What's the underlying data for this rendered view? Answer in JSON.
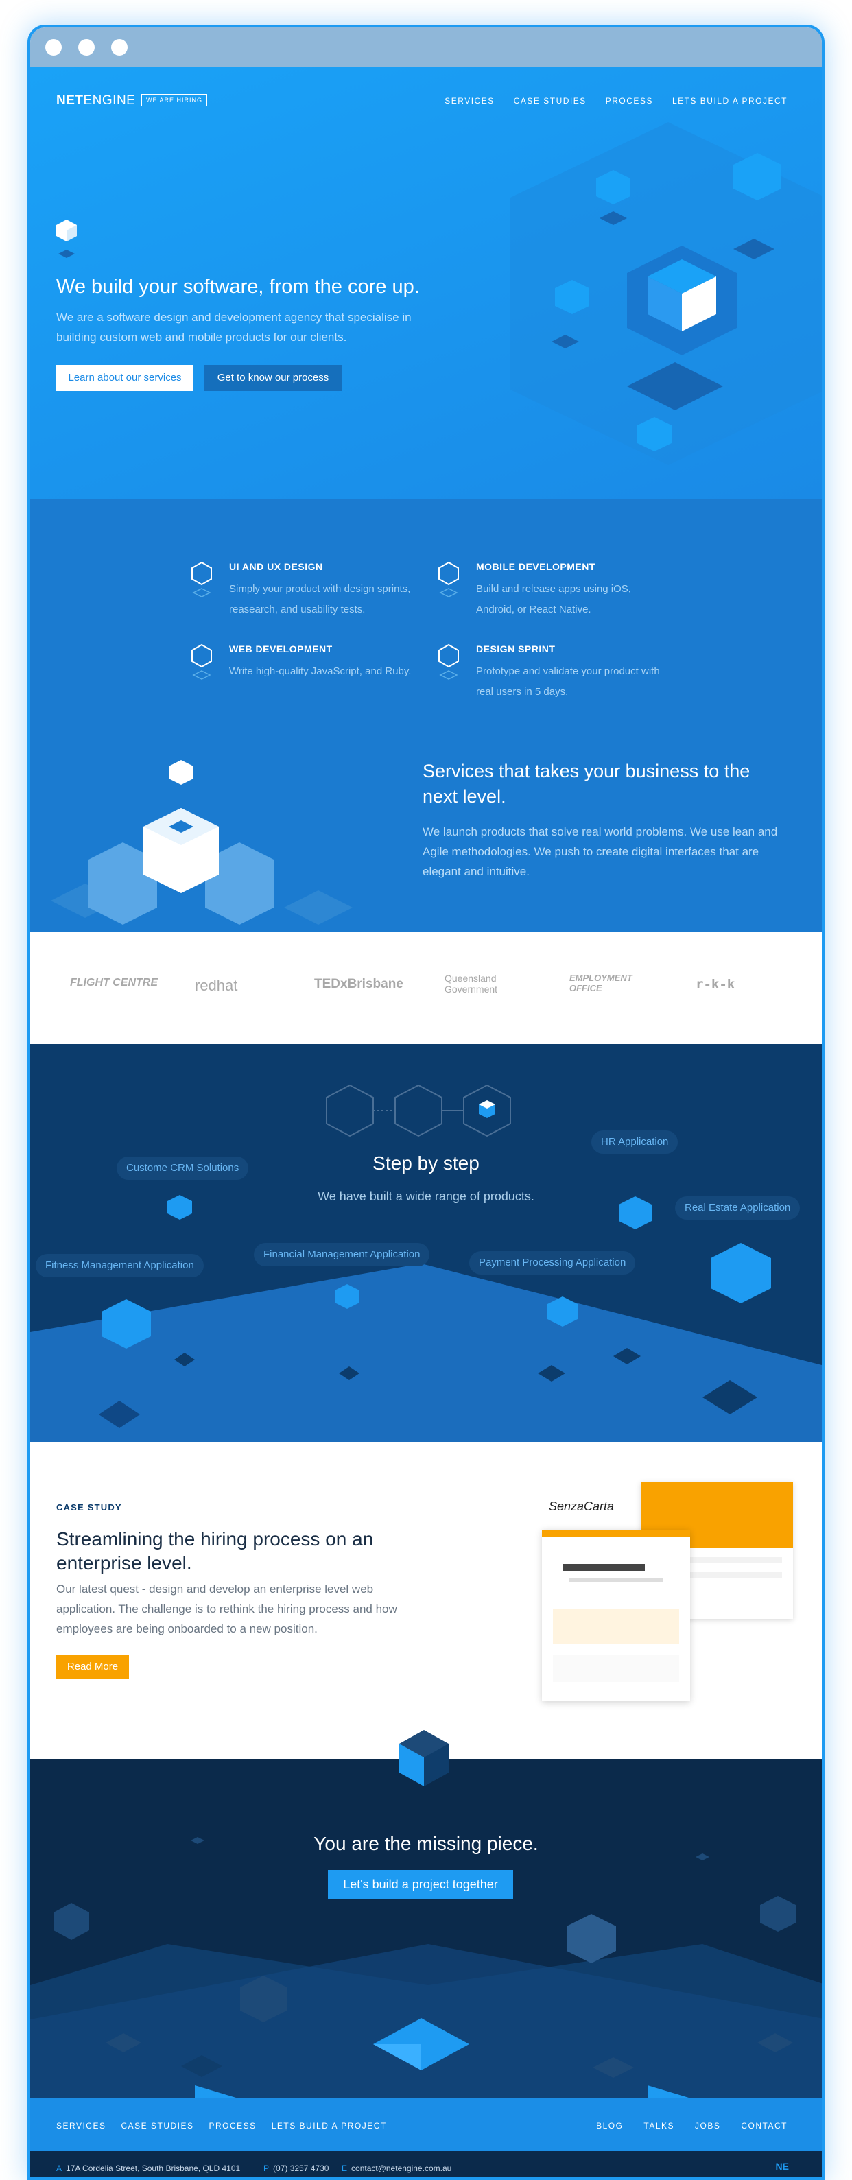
{
  "nav": {
    "logo_bold": "NET",
    "logo_rest": "ENGINE",
    "hiring_badge": "WE ARE HIRING",
    "links": [
      "SERVICES",
      "CASE STUDIES",
      "PROCESS",
      "LETS BUILD A PROJECT"
    ]
  },
  "hero": {
    "title": "We build your software, from the core up.",
    "subtitle": "We are a software design and development agency that specialise in building  custom web and mobile products for our clients.",
    "primary_button": "Learn about our services",
    "secondary_button": "Get to know our process"
  },
  "services": {
    "items": [
      {
        "title": "UI AND UX DESIGN",
        "text": "Simply your product with design sprints, reasearch, and usability tests."
      },
      {
        "title": "MOBILE DEVELOPMENT",
        "text": "Build and release apps using iOS, Android, or React Native."
      },
      {
        "title": "WEB DEVELOPMENT",
        "text": "Write high-quality JavaScript, and Ruby."
      },
      {
        "title": "DESIGN SPRINT",
        "text": "Prototype and validate your product with real users in 5 days."
      }
    ],
    "headline": "Services that takes your business to the next level.",
    "body": "We launch products that solve real world problems. We use lean and Agile methodologies. We push to create digital interfaces that are elegant and intuitive."
  },
  "clients": {
    "logos": [
      "FLIGHT CENTRE",
      "redhat",
      "TEDxBrisbane",
      "Queensland Government",
      "EMPLOYMENT OFFICE",
      "r-k-k"
    ]
  },
  "steps": {
    "title": "Step by step",
    "subtitle": "We have built a wide range of products.",
    "products": [
      "Custome CRM Solutions",
      "HR Application",
      "Real Estate Application",
      "Financial Management Application",
      "Payment Processing Application",
      "Fitness Management Application"
    ]
  },
  "case_study": {
    "label": "CASE STUDY",
    "title": "Streamlining the hiring process on an enterprise level.",
    "text": "Our latest quest - design and develop an enterprise level web application. The challenge is to rethink the hiring process and how employees are being onboarded to a new position.",
    "button": "Read More",
    "mockup_brand": "SenzaCarta"
  },
  "cta": {
    "title": "You are the missing piece.",
    "button": "Let's build a project together"
  },
  "footer": {
    "left_links": [
      "SERVICES",
      "CASE STUDIES",
      "PROCESS",
      "LETS BUILD A PROJECT"
    ],
    "right_links": [
      "BLOG",
      "TALKS",
      "JOBS",
      "CONTACT"
    ],
    "address_prefix": "A",
    "address": "17A Cordelia Street, South Brisbane, QLD 4101",
    "phone_prefix": "P",
    "phone": "(07) 3257 4730",
    "email_prefix": "E",
    "email": "contact@netengine.com.au",
    "mark": "NE"
  },
  "colors": {
    "primary": "#1e9bf2",
    "dark": "#0b2a4b",
    "accent": "#f9a200"
  }
}
